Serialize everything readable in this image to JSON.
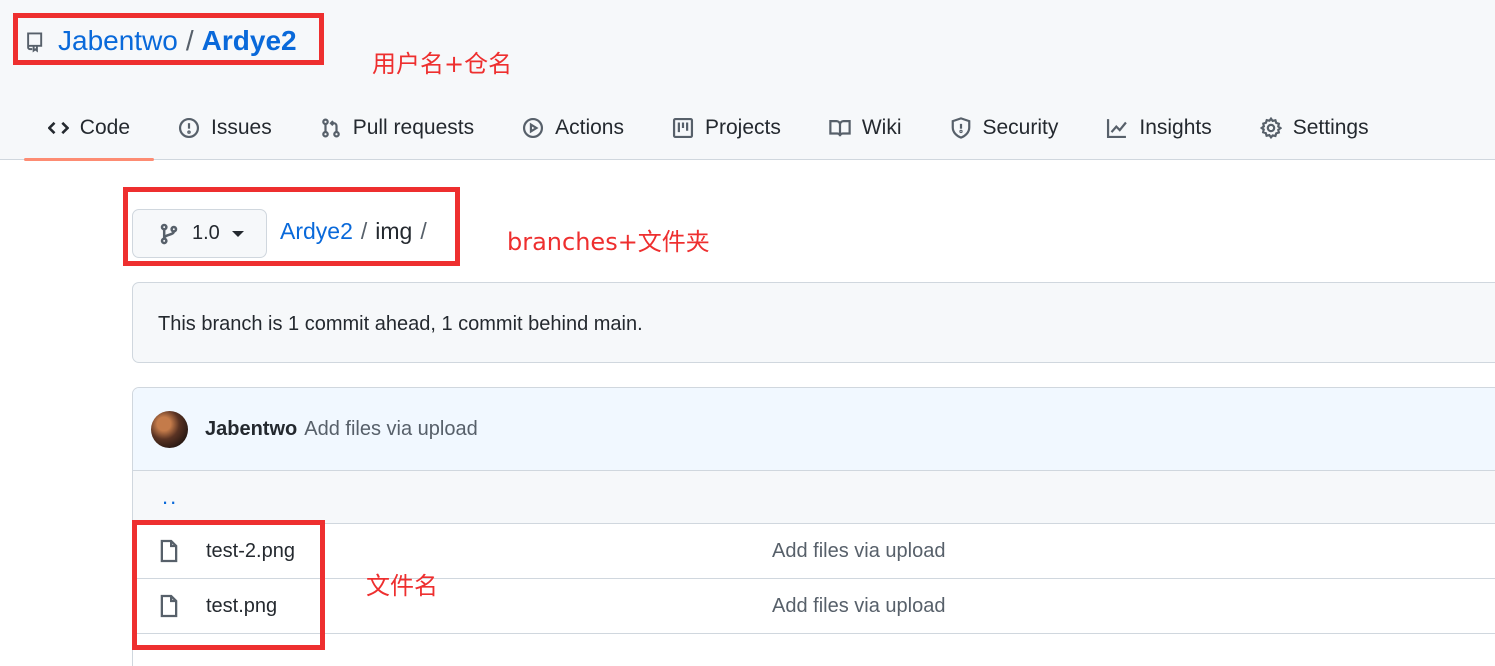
{
  "repo": {
    "owner": "Jabentwo",
    "separator": "/",
    "name": "Ardye2",
    "icon": "repo-icon"
  },
  "tabs": [
    {
      "label": "Code",
      "icon": "code-icon",
      "active": true
    },
    {
      "label": "Issues",
      "icon": "issue-icon"
    },
    {
      "label": "Pull requests",
      "icon": "pull-request-icon"
    },
    {
      "label": "Actions",
      "icon": "play-icon"
    },
    {
      "label": "Projects",
      "icon": "table-icon"
    },
    {
      "label": "Wiki",
      "icon": "book-icon"
    },
    {
      "label": "Security",
      "icon": "shield-icon"
    },
    {
      "label": "Insights",
      "icon": "graph-icon"
    },
    {
      "label": "Settings",
      "icon": "gear-icon"
    }
  ],
  "branch": {
    "label": "1.0",
    "icon": "git-branch-icon"
  },
  "breadcrumb": {
    "root": "Ardye2",
    "sep1": "/",
    "folder": "img",
    "sep2": "/"
  },
  "branch_status": "This branch is 1 commit ahead, 1 commit behind main.",
  "latest_commit": {
    "author": "Jabentwo",
    "message": "Add files via upload"
  },
  "parent_dir": "..",
  "files": [
    {
      "name": "test-2.png",
      "commit": "Add files via upload",
      "icon": "file-icon"
    },
    {
      "name": "test.png",
      "commit": "Add files via upload",
      "icon": "file-icon"
    }
  ],
  "annotations": {
    "repo_note": "用户名+仓名",
    "branch_note": "branches+文件夹",
    "file_note": "文件名",
    "color": "#ee2f2f"
  },
  "colors": {
    "link": "#0969da",
    "active_tab_underline": "#fd8c73",
    "header_bg": "#f6f8fa"
  }
}
